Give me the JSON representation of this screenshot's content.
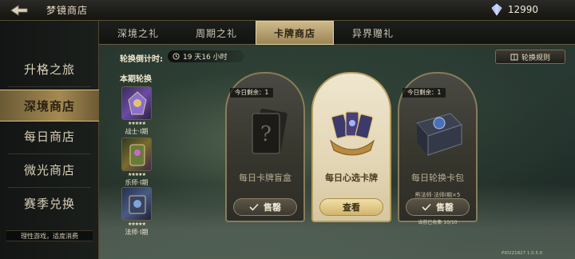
{
  "header": {
    "title": "梦镜商店",
    "currency": "12990"
  },
  "nav": {
    "items": [
      {
        "label": "升格之旅",
        "active": false
      },
      {
        "label": "深境商店",
        "active": true
      },
      {
        "label": "每日商店",
        "active": false
      },
      {
        "label": "微光商店",
        "active": false
      },
      {
        "label": "赛季兑换",
        "active": false
      }
    ],
    "footer": "理性游戏，适度消费"
  },
  "tabs": [
    {
      "label": "深境之礼",
      "active": false
    },
    {
      "label": "周期之礼",
      "active": false
    },
    {
      "label": "卡牌商店",
      "active": true
    },
    {
      "label": "异界赠礼",
      "active": false
    }
  ],
  "countdown": {
    "label": "轮换倒计时:",
    "value": "19 天16 小时"
  },
  "rules_label": "轮换规则",
  "rotation": {
    "title": "本期轮换",
    "items": [
      {
        "label": "战士·I期",
        "stars": "★★★★★"
      },
      {
        "label": "乐师·I期",
        "stars": "★★★★★"
      },
      {
        "label": "法师·I期",
        "stars": "★★★★★"
      }
    ]
  },
  "cards": [
    {
      "remaining": "今日剩余：1",
      "name": "每日卡牌盲盒",
      "button": "售罄",
      "note": "",
      "collected": ""
    },
    {
      "remaining": "",
      "name": "每日心选卡牌",
      "button": "查看",
      "note": "",
      "collected": ""
    },
    {
      "remaining": "今日剩余：1",
      "name": "每日轮换卡包",
      "button": "售罄",
      "note": "熊法师·法师I期×5",
      "collected": "当前已收集 10/10"
    }
  ],
  "build": "PID221827 1.0.5.0",
  "colors": {
    "accent": "#cdb98a",
    "nav_active": "#a48a52",
    "gem": "#9fb6ff"
  }
}
